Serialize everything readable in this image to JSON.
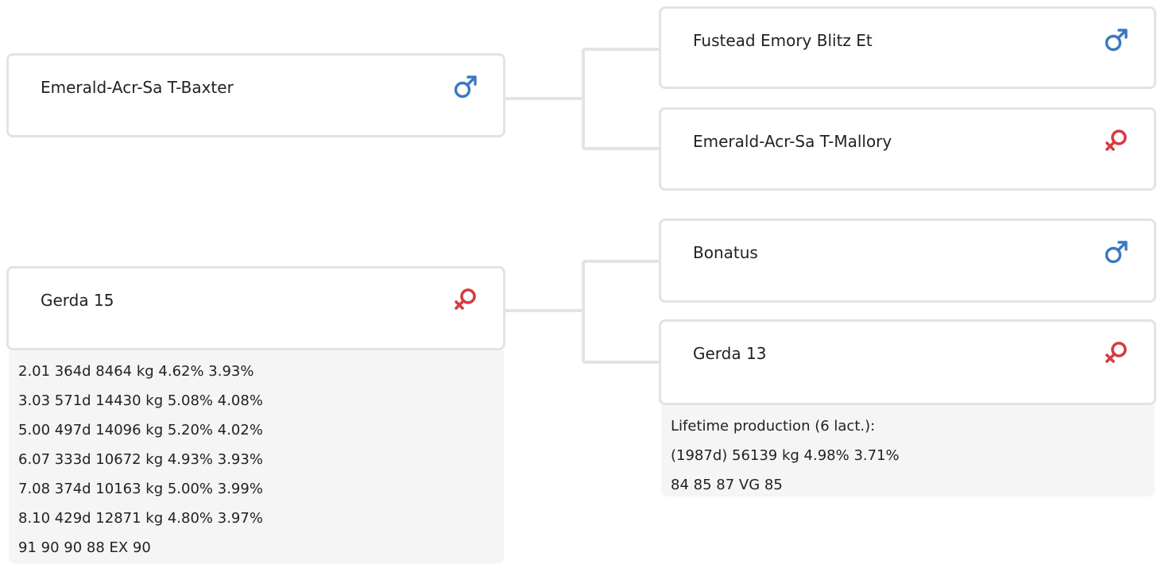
{
  "colors": {
    "male": "#3a78c3",
    "female": "#d63a3f",
    "border": "#e3e3e3",
    "info_bg": "#f5f5f5"
  },
  "pedigree": {
    "sire": {
      "name": "Emerald-Acr-Sa T-Baxter",
      "sex": "male",
      "sex_icon": "male-icon",
      "sire": {
        "name": "Fustead Emory Blitz Et",
        "sex": "male",
        "sex_icon": "male-icon"
      },
      "dam": {
        "name": "Emerald-Acr-Sa T-Mallory",
        "sex": "female",
        "sex_icon": "female-icon"
      }
    },
    "dam": {
      "name": "Gerda 15",
      "sex": "female",
      "sex_icon": "female-icon",
      "production": [
        "2.01 364d 8464 kg 4.62% 3.93%",
        "3.03 571d 14430 kg 5.08% 4.08%",
        "5.00 497d 14096 kg 5.20% 4.02%",
        "6.07 333d 10672 kg 4.93% 3.93%",
        "7.08 374d 10163 kg 5.00% 3.99%",
        "8.10 429d 12871 kg 4.80% 3.97%",
        "91 90 90 88 EX 90"
      ],
      "sire": {
        "name": "Bonatus",
        "sex": "male",
        "sex_icon": "male-icon"
      },
      "dam": {
        "name": "Gerda 13",
        "sex": "female",
        "sex_icon": "female-icon",
        "production": [
          "Lifetime production (6 lact.):",
          "(1987d) 56139 kg 4.98% 3.71%",
          "84 85 87 VG 85"
        ]
      }
    }
  }
}
